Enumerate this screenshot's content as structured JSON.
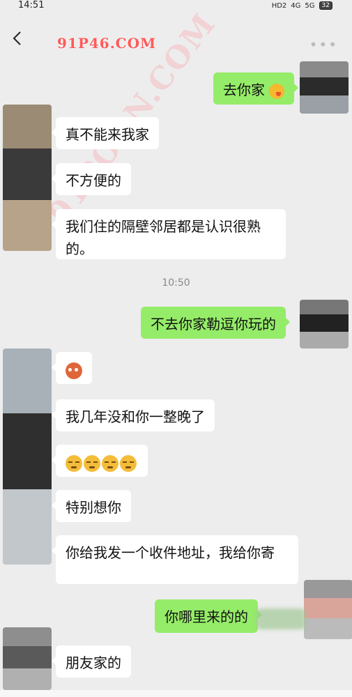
{
  "status": {
    "time": "14:51",
    "hd": "HD2",
    "network1": "4G",
    "network2": "5G",
    "battery": "32"
  },
  "header": {
    "watermark": "91P46.COM",
    "diagonal_watermark": "91PORN.COM"
  },
  "timestamp": "10:50",
  "messages": [
    {
      "dir": "out",
      "text": "去你家",
      "emoji": "wink"
    },
    {
      "dir": "in",
      "text": "真不能来我家"
    },
    {
      "dir": "in",
      "text": "不方便的"
    },
    {
      "dir": "in",
      "line1": "我们住的隔壁邻居都是认识很熟",
      "line2": "的。"
    },
    {
      "dir": "out",
      "text": "不去你家勒逗你玩的"
    },
    {
      "dir": "in",
      "emoji": "sick"
    },
    {
      "dir": "in",
      "text": "我几年没和你一整晚了"
    },
    {
      "dir": "in",
      "emoji": "tired",
      "count": 4
    },
    {
      "dir": "in",
      "text": "特别想你"
    },
    {
      "dir": "in",
      "text": "你给我发一个收件地址，我给你寄"
    },
    {
      "dir": "out",
      "text": "你哪里来的的"
    },
    {
      "dir": "in",
      "text": "朋友家的"
    }
  ]
}
